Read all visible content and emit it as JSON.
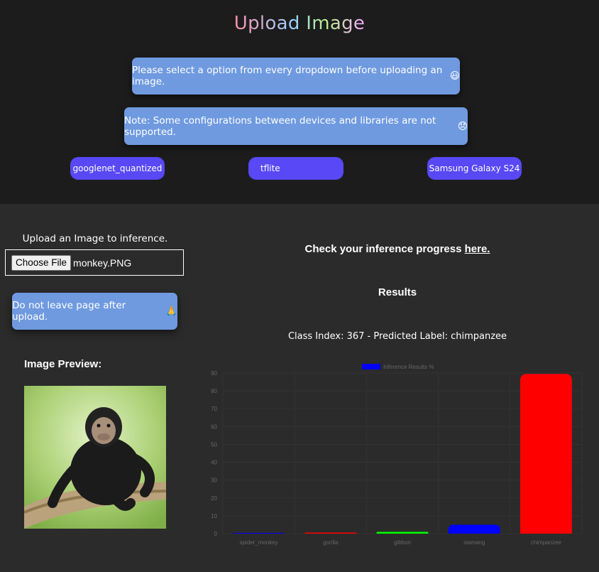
{
  "header": {
    "title": "Upload Image",
    "note_select": "Please select a option from every dropdown before uploading an image.",
    "note_select_emoji": "😃",
    "note_config": "Note: Some configurations between devices and libraries are not supported.",
    "note_config_emoji": "😞",
    "dropdowns": {
      "model": "googlenet_quantized",
      "library": "tflite",
      "device": "Samsung Galaxy S24"
    }
  },
  "upload": {
    "label": "Upload an Image to inference.",
    "choose_file_label": "Choose File",
    "file_name": "monkey.PNG",
    "warning": "Do not leave page after upload.",
    "warning_emoji": "🙏",
    "preview_title": "Image Preview:"
  },
  "results": {
    "progress_text": "Check your inference progress",
    "progress_link": "here.",
    "title": "Results",
    "predicted": "Class Index: 367 - Predicted Label: chimpanzee"
  },
  "chart_data": {
    "type": "bar",
    "legend": "Inference Results %",
    "legend_color": "#0000ff",
    "categories": [
      "spider_monkey",
      "gorilla",
      "gibbon",
      "siamang",
      "chimpanzee"
    ],
    "values": [
      0.2,
      0.6,
      1.0,
      5.0,
      89.5
    ],
    "colors": [
      "#0000ff",
      "#ff0000",
      "#00ff00",
      "#0000ff",
      "#ff0000"
    ],
    "ylim": [
      0,
      90
    ],
    "yticks": [
      "0",
      "10",
      "20",
      "30",
      "40",
      "50",
      "60",
      "70",
      "80",
      "90"
    ],
    "grid": true
  }
}
